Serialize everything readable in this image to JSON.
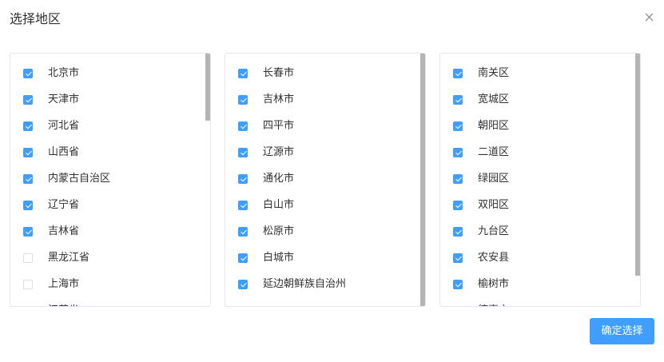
{
  "dialog": {
    "title": "选择地区",
    "confirm_label": "确定选择"
  },
  "columns": [
    {
      "name": "province",
      "items": [
        {
          "label": "北京市",
          "checked": true
        },
        {
          "label": "天津市",
          "checked": true
        },
        {
          "label": "河北省",
          "checked": true
        },
        {
          "label": "山西省",
          "checked": true
        },
        {
          "label": "内蒙古自治区",
          "checked": true
        },
        {
          "label": "辽宁省",
          "checked": true
        },
        {
          "label": "吉林省",
          "checked": true
        },
        {
          "label": "黑龙江省",
          "checked": false
        },
        {
          "label": "上海市",
          "checked": false
        },
        {
          "label": "江苏省",
          "checked": false
        }
      ]
    },
    {
      "name": "city",
      "items": [
        {
          "label": "长春市",
          "checked": true
        },
        {
          "label": "吉林市",
          "checked": true
        },
        {
          "label": "四平市",
          "checked": true
        },
        {
          "label": "辽源市",
          "checked": true
        },
        {
          "label": "通化市",
          "checked": true
        },
        {
          "label": "白山市",
          "checked": true
        },
        {
          "label": "松原市",
          "checked": true
        },
        {
          "label": "白城市",
          "checked": true
        },
        {
          "label": "延边朝鲜族自治州",
          "checked": true
        }
      ]
    },
    {
      "name": "district",
      "items": [
        {
          "label": "南关区",
          "checked": true
        },
        {
          "label": "宽城区",
          "checked": true
        },
        {
          "label": "朝阳区",
          "checked": true
        },
        {
          "label": "二道区",
          "checked": true
        },
        {
          "label": "绿园区",
          "checked": true
        },
        {
          "label": "双阳区",
          "checked": true
        },
        {
          "label": "九台区",
          "checked": true
        },
        {
          "label": "农安县",
          "checked": true
        },
        {
          "label": "榆树市",
          "checked": true
        },
        {
          "label": "德惠市",
          "checked": true
        }
      ]
    }
  ],
  "colors": {
    "accent": "#409eff",
    "border": "#e4e7ed",
    "text": "#303133"
  },
  "icons": {
    "close": "close-icon"
  }
}
